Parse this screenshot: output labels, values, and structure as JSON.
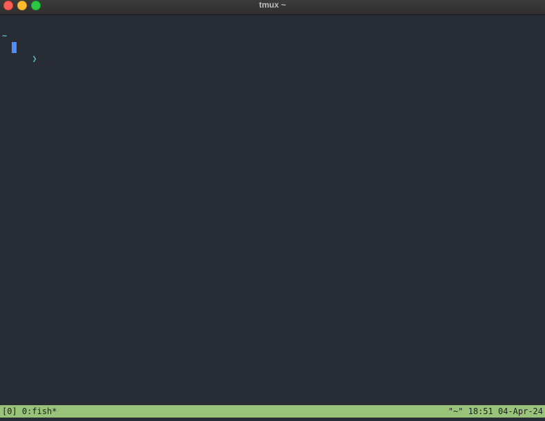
{
  "window": {
    "title": "tmux ~",
    "controls": [
      "close",
      "minimize",
      "maximize"
    ]
  },
  "terminal": {
    "cwd_line": "~",
    "prompt_symbol": "❯",
    "input": "",
    "cursor_style": "block"
  },
  "status_bar": {
    "session": "[0]",
    "window_label": "0:fish*",
    "right": {
      "pane_title": "\"~\"",
      "time": "18:51",
      "date": "04-Apr-24"
    }
  },
  "colors": {
    "background": "#282c34",
    "prompt": "#56b6c2",
    "cursor": "#528bff",
    "status_bar": "#98c379",
    "status_text": "#1c1f24"
  }
}
